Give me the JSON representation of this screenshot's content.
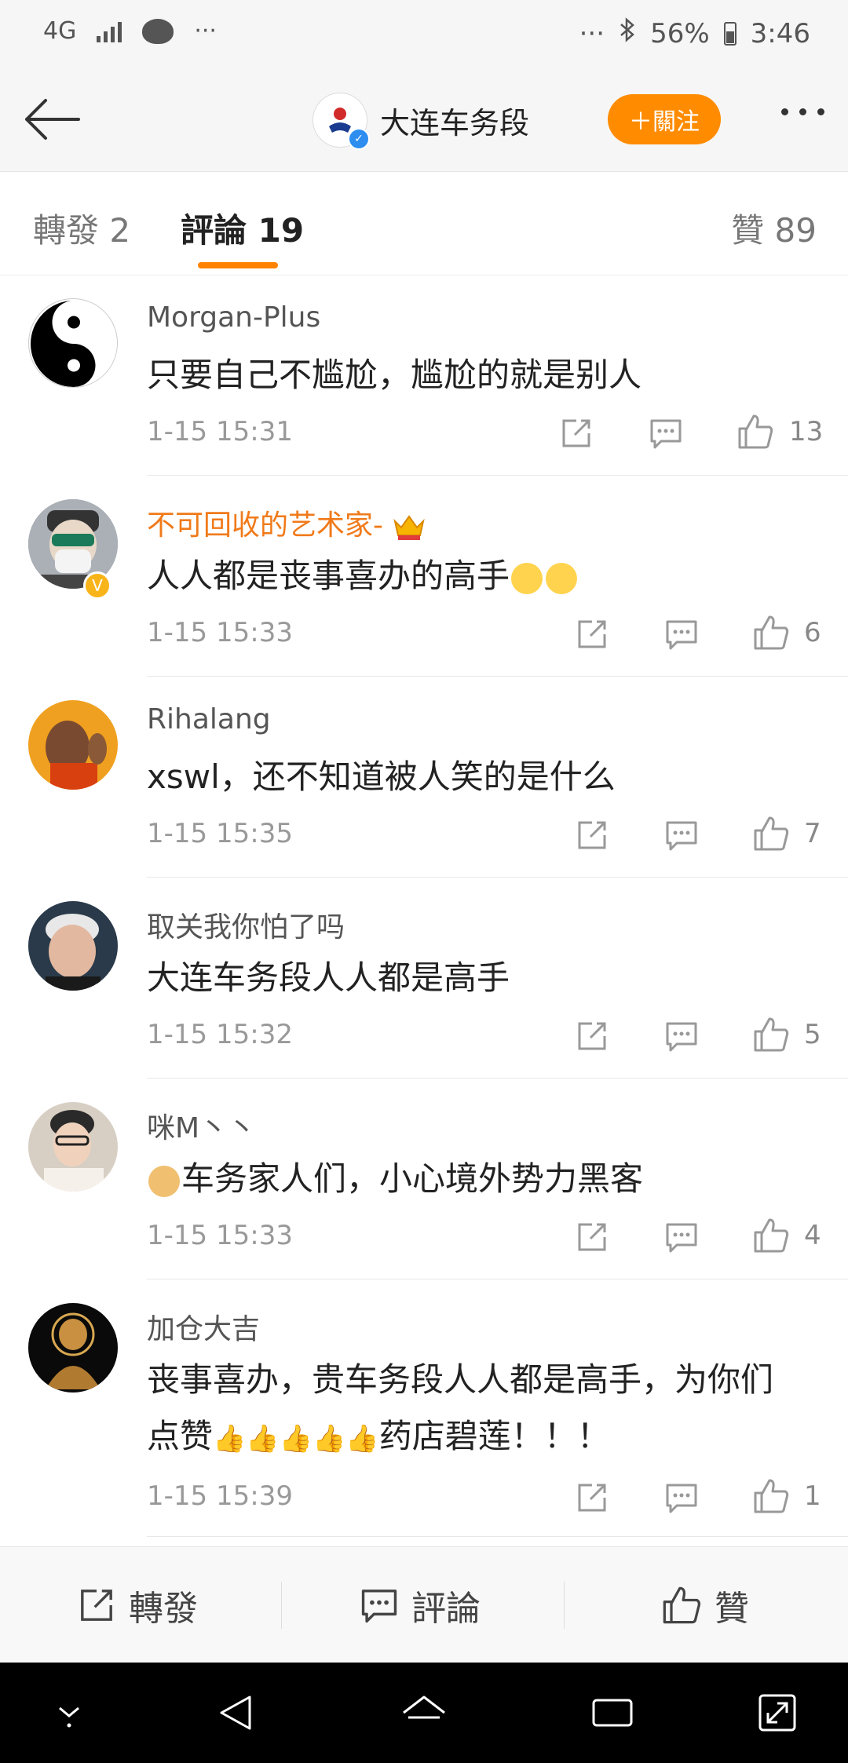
{
  "status_bar": {
    "network": "4G",
    "dots_left": "···",
    "dots_right": "···",
    "battery": "56%",
    "time": "3:46"
  },
  "header": {
    "account_name": "大连车务段",
    "follow_label": "＋關注"
  },
  "tabs": {
    "repost": "轉發 2",
    "comments": "評論 19",
    "likes": "贊 89"
  },
  "comments": [
    {
      "user": "Morgan-Plus",
      "text": "只要自己不尴尬，尴尬的就是别人",
      "time": "1-15 15:31",
      "likes": "13"
    },
    {
      "user": "不可回收的艺术家-",
      "text": "人人都是丧事喜办的高手",
      "time": "1-15 15:33",
      "likes": "6"
    },
    {
      "user": "Rihalang",
      "text": "xswl，还不知道被人笑的是什么",
      "time": "1-15 15:35",
      "likes": "7"
    },
    {
      "user": "取关我你怕了吗",
      "text": "大连车务段人人都是高手",
      "time": "1-15 15:32",
      "likes": "5"
    },
    {
      "user": "咪M丶丶",
      "text": "车务家人们，小心境外势力黑客",
      "time": "1-15 15:33",
      "likes": "4"
    },
    {
      "user": "加仓大吉",
      "text_line1": "丧事喜办，贵车务段人人都是高手，为你们",
      "text_line2_a": "点赞",
      "text_line2_b": "药店碧莲！！！",
      "time": "1-15 15:39",
      "likes": "1"
    }
  ],
  "action_bar": {
    "repost": "轉發",
    "comment": "評論",
    "like": "贊"
  },
  "colors": {
    "accent_orange": "#ff8200",
    "vip_name": "#f07a1a"
  }
}
